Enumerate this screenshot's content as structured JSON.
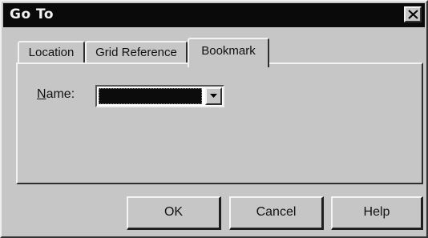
{
  "window": {
    "title": "Go To"
  },
  "tabs": [
    {
      "label": "Location",
      "active": false
    },
    {
      "label": "Grid Reference",
      "active": false
    },
    {
      "label": "Bookmark",
      "active": true
    }
  ],
  "bookmark": {
    "name_label_underlined": "N",
    "name_label_rest": "ame:",
    "name_value": ""
  },
  "buttons": {
    "ok": "OK",
    "cancel": "Cancel",
    "help": "Help"
  },
  "icons": {
    "close": "close-icon",
    "dropdown": "chevron-down-icon"
  }
}
